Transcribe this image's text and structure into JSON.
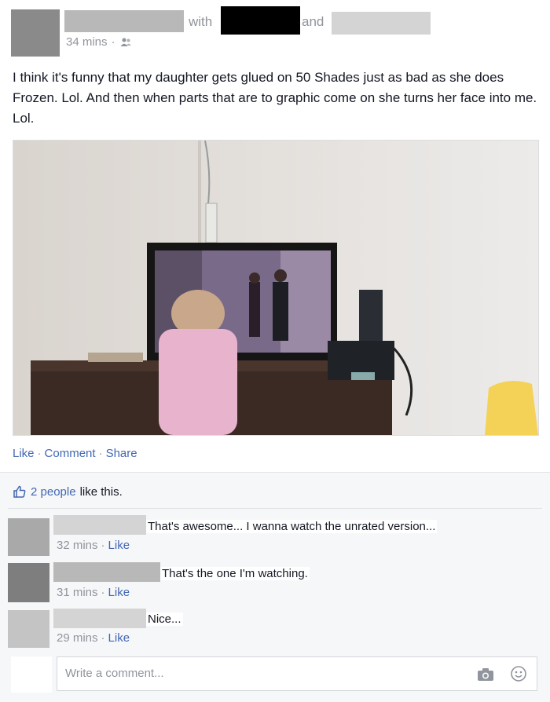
{
  "post": {
    "with_text": "with",
    "and_text": "and",
    "timestamp": "34 mins",
    "separator": "·",
    "audience_icon": "friends-icon",
    "body": "I think it's funny that my daughter gets glued on 50 Shades just as bad as she does Frozen. Lol. And then when parts that are to graphic come on she turns her face into me. Lol.",
    "actions": {
      "like": "Like",
      "comment": "Comment",
      "share": "Share"
    }
  },
  "likes": {
    "icon": "thumbs-up-icon",
    "count_text": "2 people",
    "suffix": "like this."
  },
  "comments": [
    {
      "text": "That's awesome... I wanna watch the unrated version...",
      "time": "32 mins",
      "like": "Like"
    },
    {
      "text": "That's the one I'm watching.",
      "time": "31 mins",
      "like": "Like"
    },
    {
      "text": "Nice...",
      "time": "29 mins",
      "like": "Like"
    }
  ],
  "composer": {
    "placeholder": "Write a comment...",
    "camera_icon": "camera-icon",
    "emoji_icon": "smiley-icon"
  },
  "colors": {
    "link": "#4267b2",
    "meta": "#90949c",
    "ufi_bg": "#f6f7f9"
  }
}
